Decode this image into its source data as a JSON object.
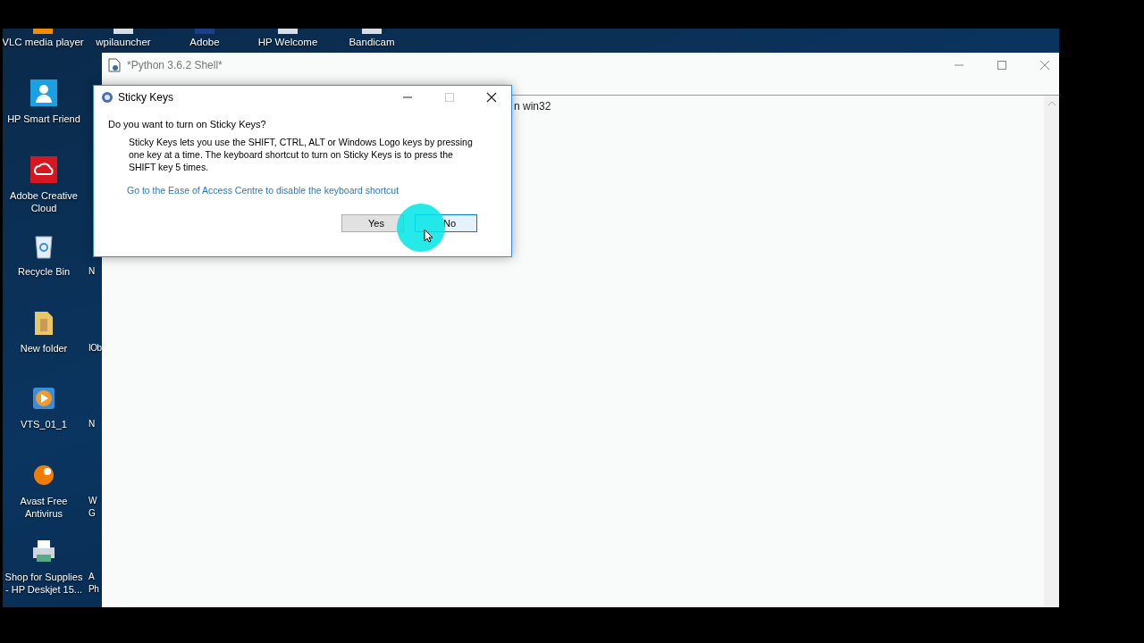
{
  "desktop": {
    "top_icons": [
      {
        "label": "VLC media player",
        "kind": "vlc"
      },
      {
        "label": "wpilauncher",
        "kind": "app"
      },
      {
        "label": "Adobe",
        "kind": "adobe"
      },
      {
        "label": "HP Welcome",
        "kind": "app"
      },
      {
        "label": "Bandicam",
        "kind": "app"
      }
    ],
    "left_icons": [
      {
        "label": "HP Smart Friend",
        "kind": "person"
      },
      {
        "label": "Adobe Creative Cloud",
        "kind": "cloud"
      },
      {
        "label": "Recycle Bin",
        "kind": "bin"
      },
      {
        "label": "New folder",
        "kind": "folder"
      },
      {
        "label": "VTS_01_1",
        "kind": "video"
      },
      {
        "label": "Avast Free Antivirus",
        "kind": "avast"
      },
      {
        "label": "Shop for Supplies - HP Deskjet 15...",
        "kind": "printer"
      }
    ],
    "cut_labels": [
      "N",
      "IOb",
      "N",
      "W G",
      "A Ph"
    ]
  },
  "shell_window": {
    "title": "*Python 3.6.2 Shell*",
    "text": "n win32"
  },
  "dialog": {
    "title": "Sticky Keys",
    "question": "Do you want to turn on Sticky Keys?",
    "body": "Sticky Keys lets you use the SHIFT, CTRL, ALT or Windows Logo keys by pressing one key at a time. The keyboard shortcut to turn on Sticky Keys is to press the SHIFT key 5 times.",
    "link": "Go to the Ease of Access Centre to disable the keyboard shortcut",
    "buttons": [
      {
        "label": "Yes",
        "selected": false
      },
      {
        "label": "No",
        "selected": true
      }
    ]
  }
}
